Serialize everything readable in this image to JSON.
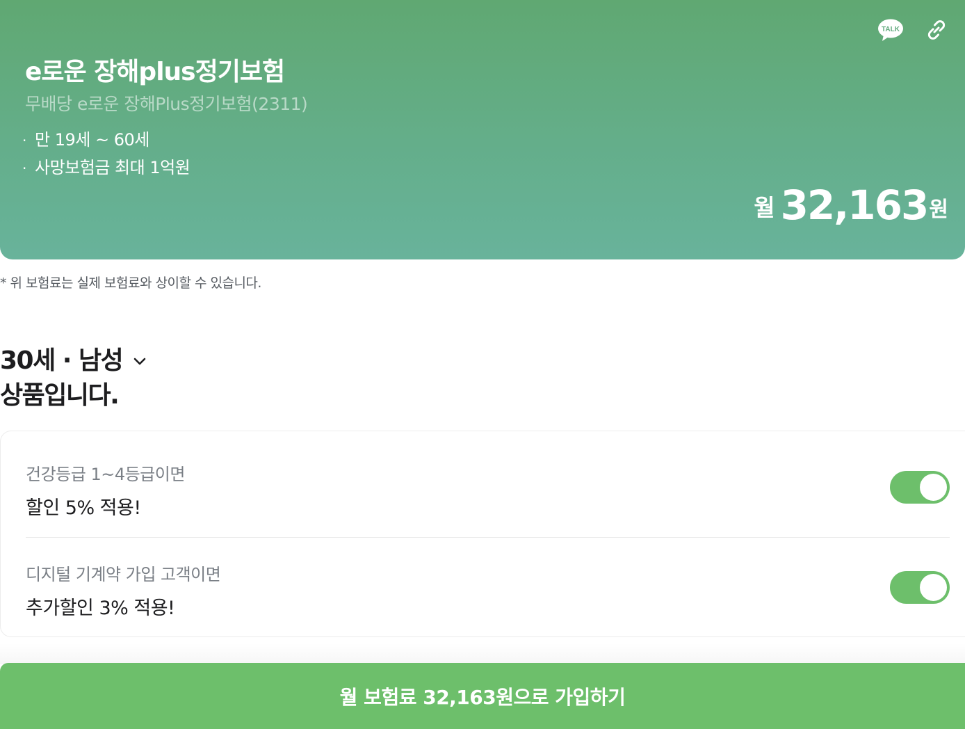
{
  "hero": {
    "title": "e로운 장해plus정기보험",
    "subtitle": "무배당 e로운 장해Plus정기보험(2311)",
    "features": [
      "만 19세 ~ 60세",
      "사망보험금 최대 1억원"
    ],
    "feature_bullet": "·",
    "price": {
      "prefix": "월",
      "amount": "32,163",
      "suffix": "원"
    },
    "share_icons": [
      "kakaotalk-icon",
      "link-icon"
    ],
    "talk_label": "TALK"
  },
  "notice": "* 위 보험료는 실제 보험료와 상이할 수 있습니다.",
  "profile": {
    "selection": "30세 · 남성",
    "tail": "상품입니다."
  },
  "discounts": [
    {
      "condition": "건강등급 1~4등급이면",
      "benefit": "할인 5% 적용!",
      "enabled": true
    },
    {
      "condition": "디지털 기계약 가입 고객이면",
      "benefit": "추가할인 3% 적용!",
      "enabled": true
    }
  ],
  "cta": {
    "label": "월 보험료 32,163원으로 가입하기"
  },
  "colors": {
    "hero_top": "#60a872",
    "hero_bottom": "#68b39b",
    "accent": "#6dbf6b",
    "text_dark": "#1d1d1f",
    "text_muted": "#7a7f86"
  }
}
